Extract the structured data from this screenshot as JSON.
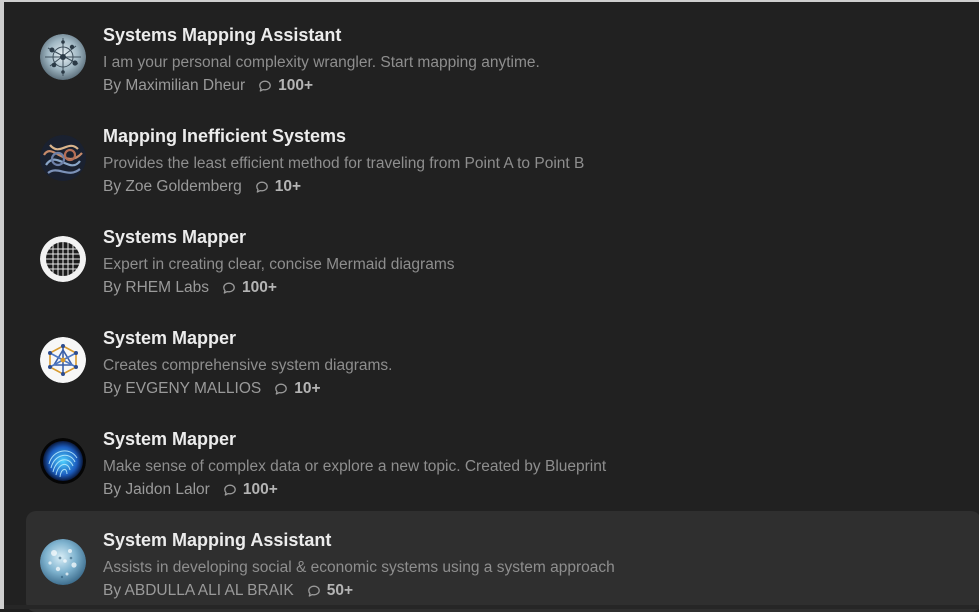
{
  "items": [
    {
      "title": "Systems Mapping Assistant",
      "description": "I am your personal complexity wrangler. Start mapping anytime.",
      "author": "By Maximilian Dheur",
      "count": "100+",
      "avatar_icon": "network-globe-avatar"
    },
    {
      "title": "Mapping Inefficient Systems",
      "description": "Provides the least efficient method for traveling from Point A to Point B",
      "author": "By Zoe Goldemberg",
      "count": "10+",
      "avatar_icon": "tangled-roads-avatar"
    },
    {
      "title": "Systems Mapper",
      "description": "Expert in creating clear, concise Mermaid diagrams",
      "author": "By RHEM Labs",
      "count": "100+",
      "avatar_icon": "grid-maze-avatar"
    },
    {
      "title": "System Mapper",
      "description": "Creates comprehensive system diagrams.",
      "author": "By EVGENY MALLIOS",
      "count": "10+",
      "avatar_icon": "geometric-node-avatar"
    },
    {
      "title": "System Mapper",
      "description": "Make sense of complex data or explore a new topic. Created by Blueprint",
      "author": "By Jaidon Lalor",
      "count": "100+",
      "avatar_icon": "blue-fingerprint-avatar"
    },
    {
      "title": "System Mapping Assistant",
      "description": "Assists in developing social & economic systems using a system approach",
      "author": "By ABDULLA ALI AL BRAIK",
      "count": "50+",
      "avatar_icon": "bokeh-globe-avatar"
    }
  ],
  "colors": {
    "background": "#212121",
    "highlight": "#2f2f2f",
    "title": "#ececec",
    "description": "#8e8e8e"
  }
}
